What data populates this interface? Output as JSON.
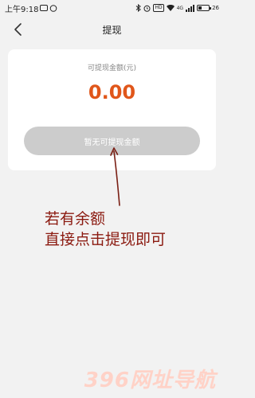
{
  "status_bar": {
    "time": "上午9:18",
    "network_label": "4G",
    "battery_level": "26",
    "colors": {
      "text": "#222222"
    }
  },
  "header": {
    "title": "提现",
    "back_icon": "chevron-left-icon"
  },
  "card": {
    "label": "可提现金额(元)",
    "amount": "0.00",
    "button_label": "暂无可提现金额",
    "colors": {
      "amount": "#e0561a",
      "button_bg": "#cccccc",
      "button_text": "#ffffff"
    }
  },
  "annotation": {
    "line1": "若有余额",
    "line2": "直接点击提现即可",
    "color": "#8b1a10"
  },
  "watermark": {
    "text": "396网址导航"
  }
}
